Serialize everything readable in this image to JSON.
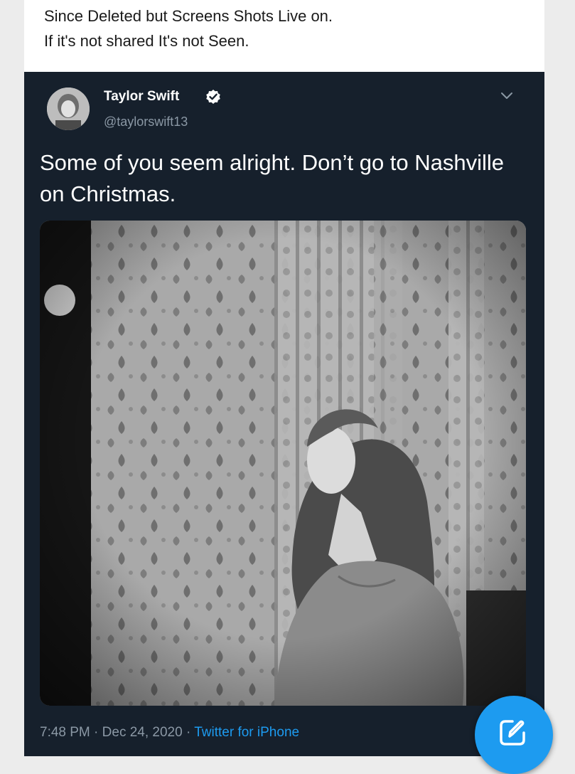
{
  "caption": {
    "line1": "Since Deleted but Screens Shots Live on.",
    "line2": "If it's not shared It's not Seen."
  },
  "tweet": {
    "display_name": "Taylor Swift",
    "handle": "@taylorswift13",
    "verified": true,
    "text": "Some of you seem alright. Don’t go to Nashville on Christmas.",
    "time": "7:48 PM",
    "separator": " · ",
    "date": "Dec 24, 2020",
    "source": "Twitter for iPhone",
    "photo": "black-and-white portrait photo"
  },
  "icons": {
    "verified": "verified-badge-icon",
    "more": "chevron-down-icon",
    "compose": "compose-tweet-icon"
  },
  "colors": {
    "card_background": "#16202c",
    "link": "#1d9bf0",
    "muted": "#8b98a5"
  }
}
